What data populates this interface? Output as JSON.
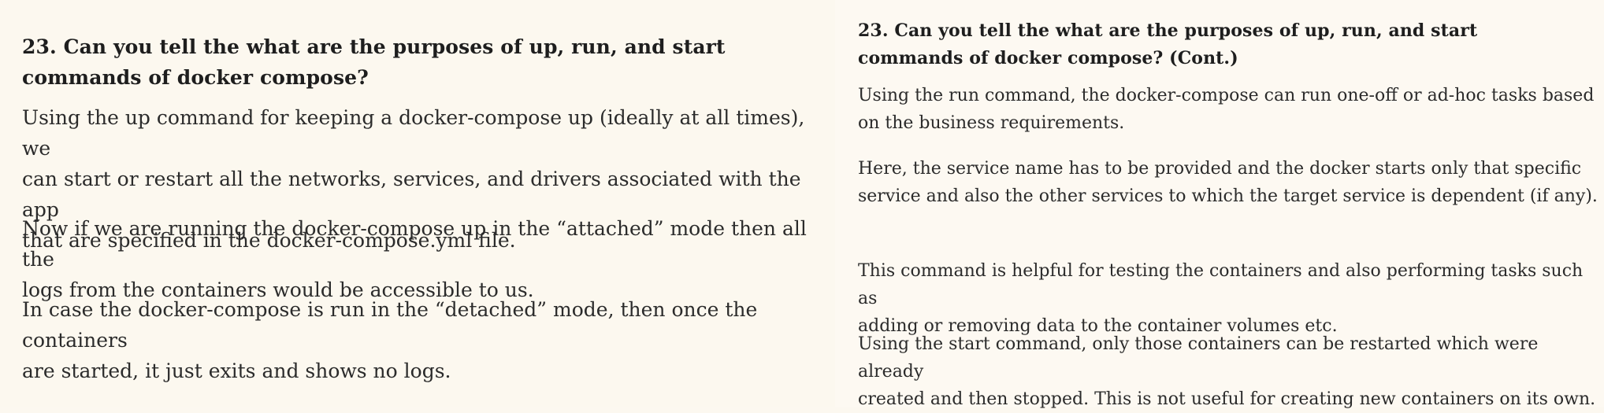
{
  "left_page": {
    "heading": "23. Can you tell the what are the purposes of up, run, and start\ncommands of docker compose?",
    "paragraphs": [
      "Using the up command for keeping a docker-compose up (ideally at all times), we\ncan start or restart all the networks, services, and drivers associated with the app\nthat are specified in the docker-compose.yml file.",
      "Now if we are running the docker-compose up in the “attached” mode then all the\nlogs from the containers would be accessible to us.",
      "In case the docker-compose is run in the “detached” mode, then once the containers\nare started, it just exits and shows no logs."
    ]
  },
  "right_page": {
    "heading": "23. Can you tell the what are the purposes of up, run, and start\ncommands of docker compose? (Cont.)",
    "paragraphs": [
      "Using the run command, the docker-compose can run one-off or ad-hoc tasks based\non the business requirements.",
      "Here, the service name has to be provided and the docker starts only that specific\nservice and also the other services to which the target service is dependent (if any).",
      "This command is helpful for testing the containers and also performing tasks such as\nadding or removing data to the container volumes etc.",
      "Using the start command, only those containers can be restarted which were already\ncreated and then stopped. This is not useful for creating new containers on its own."
    ]
  }
}
